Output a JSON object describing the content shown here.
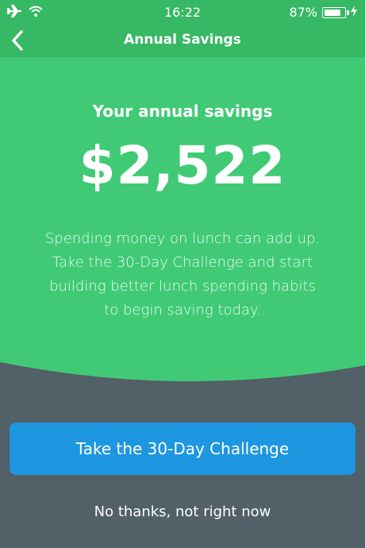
{
  "status_bar": {
    "time": "16:22",
    "battery_percent": "87%",
    "battery_level": 0.87,
    "icons": [
      "airplane-icon",
      "wifi-icon",
      "battery-icon",
      "charging-icon"
    ]
  },
  "nav": {
    "title": "Annual Savings",
    "back_icon": "chevron-left-icon"
  },
  "hero": {
    "heading": "Your annual savings",
    "amount": "$2,522",
    "description": "Spending money on lunch can add up. Take the 30-Day Challenge and start building better lunch spending habits to begin saving today."
  },
  "actions": {
    "primary_label": "Take the 30-Day Challenge",
    "secondary_label": "No thanks, not right now"
  },
  "colors": {
    "green": "#41ca76",
    "green_dark": "#37b864",
    "slate": "#526068",
    "blue": "#1e96e0"
  }
}
